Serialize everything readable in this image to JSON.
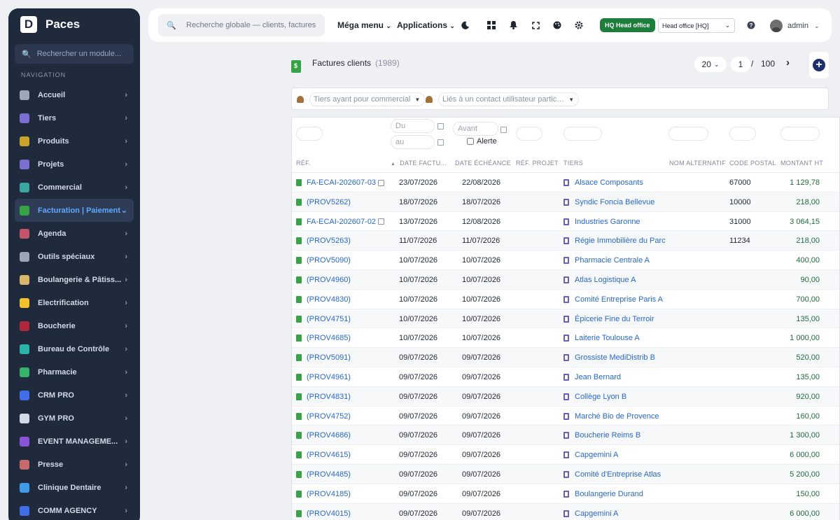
{
  "app": {
    "name": "Paces",
    "logo_letter": "D"
  },
  "sidebar": {
    "search_placeholder": "Rechercher un module...",
    "section_title": "NAVIGATION",
    "items": [
      {
        "label": "Accueil",
        "icon": "home-icon",
        "color": "#9aa6ba"
      },
      {
        "label": "Tiers",
        "icon": "building-icon",
        "color": "#7b6fd1"
      },
      {
        "label": "Produits",
        "icon": "box-icon",
        "color": "#c9a227"
      },
      {
        "label": "Projets",
        "icon": "network-icon",
        "color": "#7b6fd1"
      },
      {
        "label": "Commercial",
        "icon": "briefcase-icon",
        "color": "#3aa6a0"
      },
      {
        "label": "Facturation | Paiement",
        "icon": "invoice-icon",
        "color": "#36a346",
        "active": true
      },
      {
        "label": "Agenda",
        "icon": "calendar-icon",
        "color": "#c4556a"
      },
      {
        "label": "Outils spéciaux",
        "icon": "tools-icon",
        "color": "#9aa6ba"
      },
      {
        "label": "Boulangerie & Pâtiss...",
        "icon": "bread-icon",
        "color": "#d9b66a"
      },
      {
        "label": "Electrification",
        "icon": "bolt-icon",
        "color": "#f2c12e"
      },
      {
        "label": "Boucherie",
        "icon": "meat-icon",
        "color": "#b0263a"
      },
      {
        "label": "Bureau de Contrôle",
        "icon": "shield-icon",
        "color": "#2bb5a8"
      },
      {
        "label": "Pharmacie",
        "icon": "cross-icon",
        "color": "#36b36a"
      },
      {
        "label": "CRM PRO",
        "icon": "funnel-icon",
        "color": "#3f6ee8"
      },
      {
        "label": "GYM PRO",
        "icon": "dumbbell-icon",
        "color": "#d3dae6"
      },
      {
        "label": "EVENT MANAGEME...",
        "icon": "ticket-icon",
        "color": "#8a54d8"
      },
      {
        "label": "Presse",
        "icon": "newspaper-icon",
        "color": "#c46a6a"
      },
      {
        "label": "Clinique Dentaire",
        "icon": "tooth-icon",
        "color": "#3f9be8"
      },
      {
        "label": "COMM AGENCY",
        "icon": "funnel-icon",
        "color": "#3f6ee8"
      }
    ]
  },
  "topbar": {
    "search_placeholder": "Recherche globale — clients, factures, p",
    "mega_menu": "Méga menu",
    "applications": "Applications",
    "hq_badge": "HQ Head office",
    "office_select": "Head office [HQ]",
    "user": "admin"
  },
  "page": {
    "title": "Factures clients",
    "count": "(1989)",
    "per_page": "20",
    "current_page": "1",
    "page_sep": "/",
    "total_pages": "100"
  },
  "filters": {
    "commercial_placeholder": "Tiers ayant pour commercial",
    "contact_placeholder": "Liés à un contact utilisateur partic…",
    "date_from": "Du",
    "date_to": "au",
    "due_before": "Avant",
    "alert_label": "Alerte"
  },
  "table": {
    "columns": [
      "Réf.",
      "Date factu...",
      "Date échéance",
      "Réf. projet",
      "Tiers",
      "Nom alternatif",
      "Code postal",
      "Montant HT"
    ],
    "rows": [
      {
        "ref": "FA-ECAI-202607-03",
        "note": true,
        "date": "23/07/2026",
        "due": "22/08/2026",
        "tiers": "Alsace Composants",
        "cp": "67000",
        "amount": "1 129,78"
      },
      {
        "ref": "(PROV5262)",
        "note": false,
        "date": "18/07/2026",
        "due": "18/07/2026",
        "tiers": "Syndic Foncia Bellevue",
        "cp": "10000",
        "amount": "218,00"
      },
      {
        "ref": "FA-ECAI-202607-02",
        "note": true,
        "date": "13/07/2026",
        "due": "12/08/2026",
        "tiers": "Industries Garonne",
        "cp": "31000",
        "amount": "3 064,15"
      },
      {
        "ref": "(PROV5263)",
        "note": false,
        "date": "11/07/2026",
        "due": "11/07/2026",
        "tiers": "Régie Immobilière du Parc",
        "cp": "11234",
        "amount": "218,00"
      },
      {
        "ref": "(PROV5090)",
        "note": false,
        "date": "10/07/2026",
        "due": "10/07/2026",
        "tiers": "Pharmacie Centrale A",
        "cp": "",
        "amount": "400,00"
      },
      {
        "ref": "(PROV4960)",
        "note": false,
        "date": "10/07/2026",
        "due": "10/07/2026",
        "tiers": "Atlas Logistique A",
        "cp": "",
        "amount": "90,00"
      },
      {
        "ref": "(PROV4830)",
        "note": false,
        "date": "10/07/2026",
        "due": "10/07/2026",
        "tiers": "Comité Entreprise Paris A",
        "cp": "",
        "amount": "700,00"
      },
      {
        "ref": "(PROV4751)",
        "note": false,
        "date": "10/07/2026",
        "due": "10/07/2026",
        "tiers": "Épicerie Fine du Terroir",
        "cp": "",
        "amount": "135,00"
      },
      {
        "ref": "(PROV4685)",
        "note": false,
        "date": "10/07/2026",
        "due": "10/07/2026",
        "tiers": "Laiterie Toulouse A",
        "cp": "",
        "amount": "1 000,00"
      },
      {
        "ref": "(PROV5091)",
        "note": false,
        "date": "09/07/2026",
        "due": "09/07/2026",
        "tiers": "Grossiste MediDistrib B",
        "cp": "",
        "amount": "520,00"
      },
      {
        "ref": "(PROV4961)",
        "note": false,
        "date": "09/07/2026",
        "due": "09/07/2026",
        "tiers": "Jean Bernard",
        "cp": "",
        "amount": "135,00"
      },
      {
        "ref": "(PROV4831)",
        "note": false,
        "date": "09/07/2026",
        "due": "09/07/2026",
        "tiers": "Collège Lyon B",
        "cp": "",
        "amount": "920,00"
      },
      {
        "ref": "(PROV4752)",
        "note": false,
        "date": "09/07/2026",
        "due": "09/07/2026",
        "tiers": "Marché Bio de Provence",
        "cp": "",
        "amount": "160,00"
      },
      {
        "ref": "(PROV4686)",
        "note": false,
        "date": "09/07/2026",
        "due": "09/07/2026",
        "tiers": "Boucherie Reims B",
        "cp": "",
        "amount": "1 300,00"
      },
      {
        "ref": "(PROV4615)",
        "note": false,
        "date": "09/07/2026",
        "due": "09/07/2026",
        "tiers": "Capgemini A",
        "cp": "",
        "amount": "6 000,00"
      },
      {
        "ref": "(PROV4485)",
        "note": false,
        "date": "09/07/2026",
        "due": "09/07/2026",
        "tiers": "Comité d'Entreprise Atlas",
        "cp": "",
        "amount": "5 200,00"
      },
      {
        "ref": "(PROV4185)",
        "note": false,
        "date": "09/07/2026",
        "due": "09/07/2026",
        "tiers": "Boulangerie Durand",
        "cp": "",
        "amount": "150,00"
      },
      {
        "ref": "(PROV4015)",
        "note": false,
        "date": "09/07/2026",
        "due": "09/07/2026",
        "tiers": "Capgemini A",
        "cp": "",
        "amount": "6 000,00"
      }
    ]
  }
}
